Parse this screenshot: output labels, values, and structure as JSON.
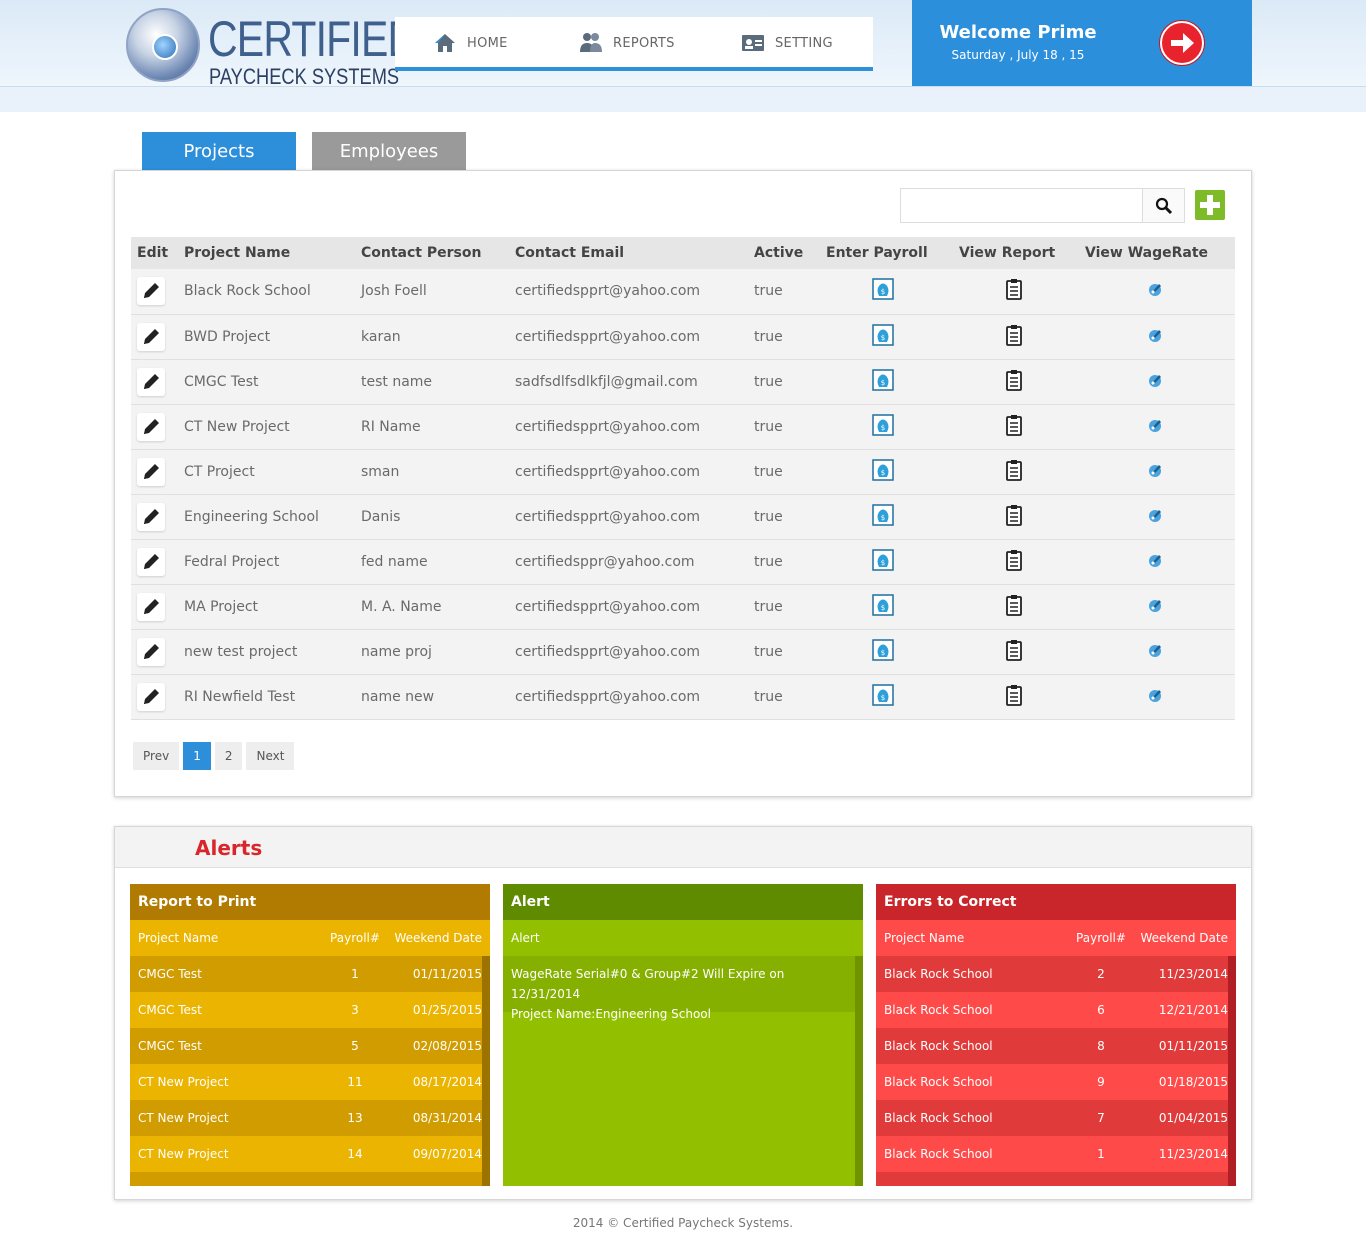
{
  "brand": {
    "title": "CERTIFIED",
    "subtitle": "PAYCHECK SYSTEMS"
  },
  "nav": [
    {
      "label": "HOME",
      "icon": "home-icon"
    },
    {
      "label": "REPORTS",
      "icon": "users-icon"
    },
    {
      "label": "SETTING",
      "icon": "id-card-icon"
    }
  ],
  "welcome": {
    "title": "Welcome Prime",
    "date": "Saturday , July 18 , 15"
  },
  "tabs": {
    "projects": "Projects",
    "employees": "Employees"
  },
  "search": {
    "placeholder": ""
  },
  "projects_table": {
    "headers": [
      "Edit",
      "Project Name",
      "Contact Person",
      "Contact Email",
      "Active",
      "Enter Payroll",
      "View Report",
      "View WageRate"
    ],
    "rows": [
      [
        "Black Rock School",
        "Josh Foell",
        "certifiedspprt@yahoo.com",
        "true"
      ],
      [
        "BWD Project",
        "karan",
        "certifiedspprt@yahoo.com",
        "true"
      ],
      [
        "CMGC Test",
        "test name",
        "sadfsdlfsdlkfjl@gmail.com",
        "true"
      ],
      [
        "CT New Project",
        "RI Name",
        "certifiedspprt@yahoo.com",
        "true"
      ],
      [
        "CT Project",
        "sman",
        "certifiedspprt@yahoo.com",
        "true"
      ],
      [
        "Engineering School",
        "Danis",
        "certifiedspprt@yahoo.com",
        "true"
      ],
      [
        "Fedral Project",
        "fed name",
        "certifiedsppr@yahoo.com",
        "true"
      ],
      [
        "MA Project",
        "M. A. Name",
        "certifiedspprt@yahoo.com",
        "true"
      ],
      [
        "new test project",
        "name proj",
        "certifiedspprt@yahoo.com",
        "true"
      ],
      [
        "RI Newfield Test",
        "name new",
        "certifiedspprt@yahoo.com",
        "true"
      ]
    ]
  },
  "pager": {
    "prev": "Prev",
    "pages": [
      "1",
      "2"
    ],
    "active": "1",
    "next": "Next"
  },
  "alerts": {
    "title": "Alerts",
    "report_to_print": {
      "title": "Report to Print",
      "headers": [
        "Project Name",
        "Payroll#",
        "Weekend Date"
      ],
      "rows": [
        [
          "CMGC Test",
          "1",
          "01/11/2015"
        ],
        [
          "CMGC Test",
          "3",
          "01/25/2015"
        ],
        [
          "CMGC Test",
          "5",
          "02/08/2015"
        ],
        [
          "CT New Project",
          "11",
          "08/17/2014"
        ],
        [
          "CT New Project",
          "13",
          "08/31/2014"
        ],
        [
          "CT New Project",
          "14",
          "09/07/2014"
        ]
      ]
    },
    "alert": {
      "title": "Alert",
      "header": "Alert",
      "message_line1": "WageRate Serial#0 & Group#2 Will Expire on 12/31/2014",
      "message_line2": "Project Name:Engineering School"
    },
    "errors_to_correct": {
      "title": "Errors to Correct",
      "headers": [
        "Project Name",
        "Payroll#",
        "Weekend Date"
      ],
      "rows": [
        [
          "Black Rock School",
          "2",
          "11/23/2014"
        ],
        [
          "Black Rock School",
          "6",
          "12/21/2014"
        ],
        [
          "Black Rock School",
          "8",
          "01/11/2015"
        ],
        [
          "Black Rock School",
          "9",
          "01/18/2015"
        ],
        [
          "Black Rock School",
          "7",
          "01/04/2015"
        ],
        [
          "Black Rock School",
          "1",
          "11/23/2014"
        ]
      ]
    }
  },
  "footer": "2014 © Certified Paycheck Systems.",
  "colors": {
    "primary_blue": "#2d8fd9",
    "logout_red": "#e8232d",
    "add_green": "#7dbb28",
    "report_title": "#b07b00",
    "report_row_dark": "#d19c00",
    "report_row_light": "#ebb400",
    "alert_title": "#5f8b00",
    "alert_body": "#92c000",
    "errors_title": "#c8262a",
    "errors_row_dark": "#e03a3a",
    "errors_row_light": "#ff4a4a"
  }
}
